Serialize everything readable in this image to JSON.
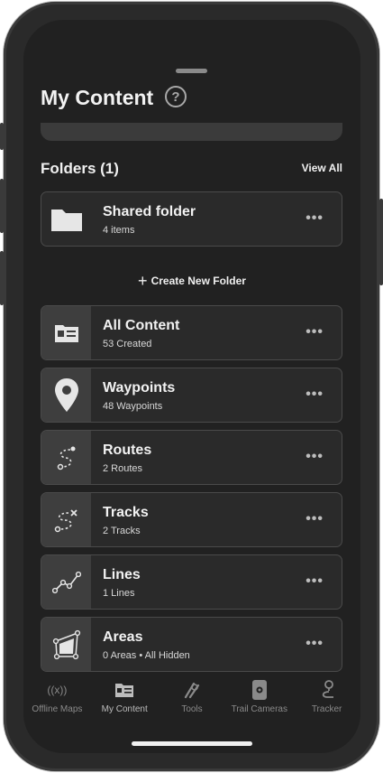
{
  "header": {
    "title": "My Content",
    "help_icon": "?"
  },
  "folders": {
    "title": "Folders (1)",
    "view_all": "View All",
    "items": [
      {
        "name": "Shared folder",
        "sub": "4 items",
        "more": "•••"
      }
    ],
    "create_label": "Create New Folder",
    "create_icon": "+"
  },
  "categories": [
    {
      "name": "All Content",
      "sub": "53 Created",
      "more": "•••"
    },
    {
      "name": "Waypoints",
      "sub": "48 Waypoints",
      "more": "•••"
    },
    {
      "name": "Routes",
      "sub": "2 Routes",
      "more": "•••"
    },
    {
      "name": "Tracks",
      "sub": "2 Tracks",
      "more": "•••"
    },
    {
      "name": "Lines",
      "sub": "1 Lines",
      "more": "•••"
    },
    {
      "name": "Areas",
      "sub": "0 Areas • All Hidden",
      "more": "•••"
    }
  ],
  "tabbar": {
    "active": "My Content",
    "tabs": [
      {
        "label": "Offline Maps",
        "icon": "offline-maps-icon",
        "glyph": "((x))"
      },
      {
        "label": "My Content",
        "icon": "my-content-icon"
      },
      {
        "label": "Tools",
        "icon": "tools-icon"
      },
      {
        "label": "Trail Cameras",
        "icon": "trail-camera-icon"
      },
      {
        "label": "Tracker",
        "icon": "tracker-icon"
      }
    ]
  },
  "colors": {
    "screen_bg": "#212121",
    "card_bg": "#2a2a2a",
    "thumb_bg": "#3e3e3e",
    "text": "#f2f2f2",
    "muted": "#8a8a8a"
  }
}
